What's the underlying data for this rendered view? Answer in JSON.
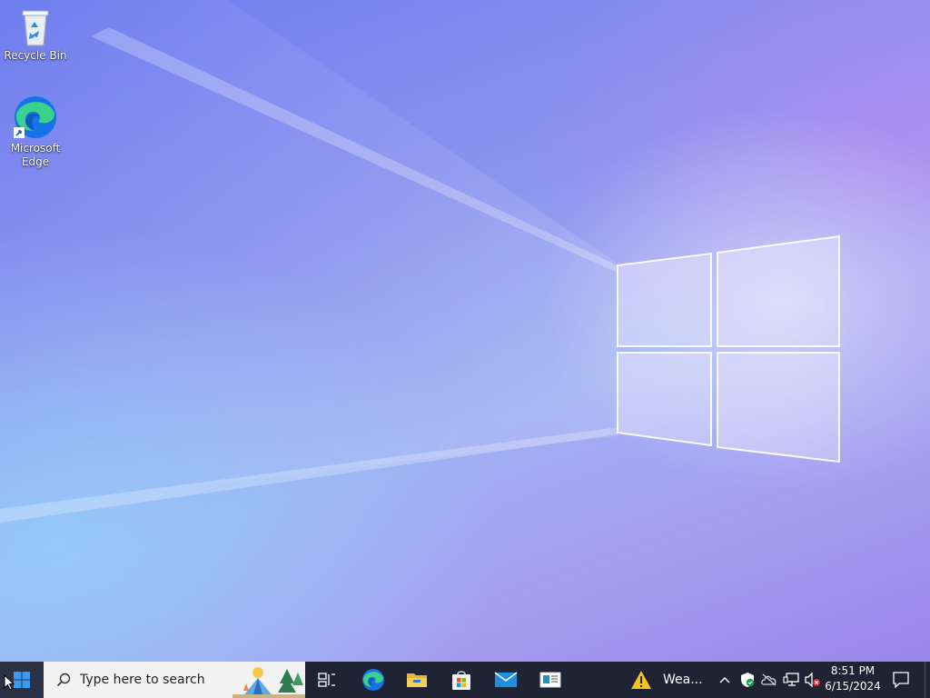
{
  "desktop": {
    "icons": [
      {
        "label": "Recycle Bin"
      },
      {
        "label_line1": "Microsoft",
        "label_line2": "Edge"
      }
    ]
  },
  "taskbar": {
    "search_placeholder": "Type here to search",
    "pinned": [
      "task-view-icon",
      "edge-icon",
      "file-explorer-icon",
      "microsoft-store-icon",
      "mail-icon",
      "news-icon"
    ],
    "weather_label": "Wea...",
    "tray": {
      "time": "8:51 PM",
      "date": "6/15/2024"
    }
  },
  "colors": {
    "taskbar_bg": "#1e2433",
    "start_logo": "#3a9cf5",
    "edge_blue": "#1473e6",
    "edge_green": "#3ad18c",
    "warning_yellow": "#f5c518"
  }
}
